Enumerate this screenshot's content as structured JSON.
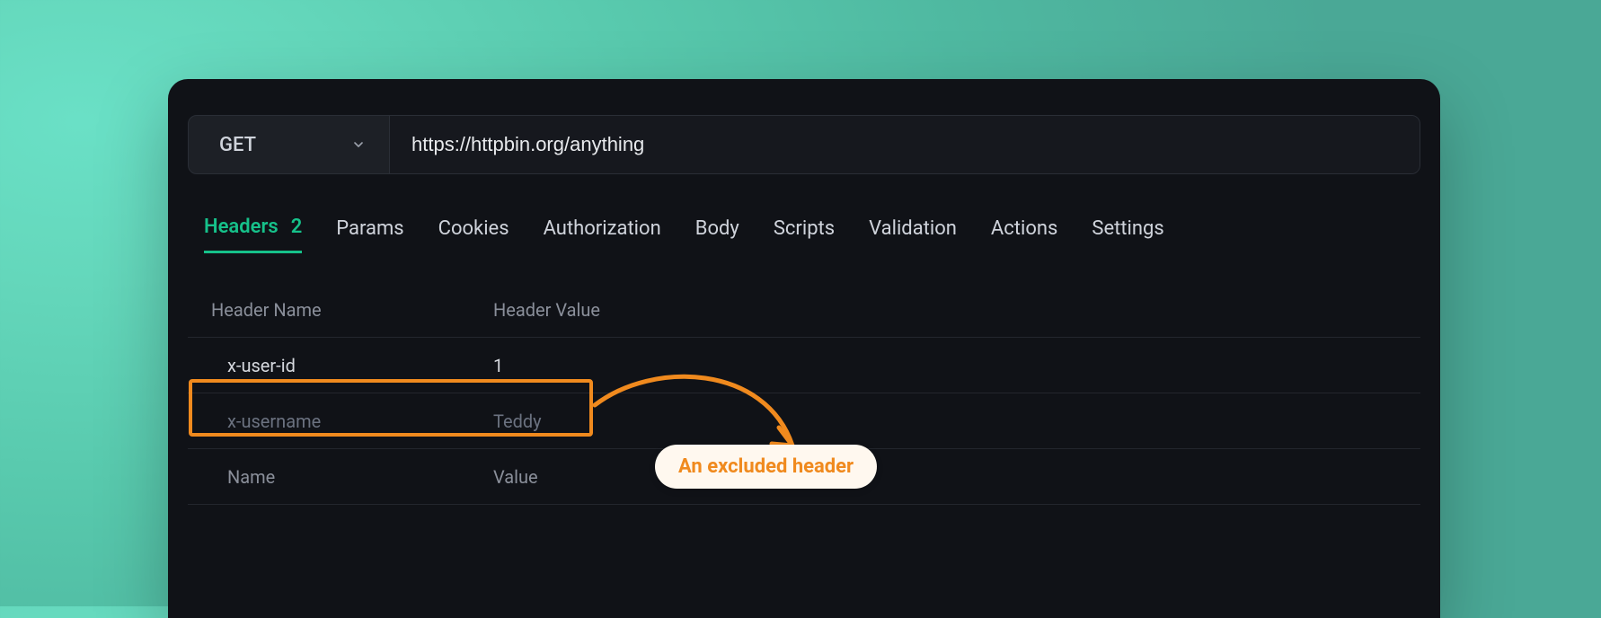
{
  "request": {
    "method": "GET",
    "url": "https://httpbin.org/anything"
  },
  "tabs": {
    "headers": {
      "label": "Headers",
      "count": "2"
    },
    "params": {
      "label": "Params"
    },
    "cookies": {
      "label": "Cookies"
    },
    "authorization": {
      "label": "Authorization"
    },
    "body": {
      "label": "Body"
    },
    "scripts": {
      "label": "Scripts"
    },
    "validation": {
      "label": "Validation"
    },
    "actions": {
      "label": "Actions"
    },
    "settings": {
      "label": "Settings"
    }
  },
  "headersTable": {
    "columns": {
      "name": "Header Name",
      "value": "Header Value"
    },
    "rows": [
      {
        "name": "x-user-id",
        "value": "1",
        "muted": false
      },
      {
        "name": "x-username",
        "value": "Teddy",
        "muted": true
      }
    ],
    "placeholder": {
      "name": "Name",
      "value": "Value"
    }
  },
  "annotation": {
    "label": "An excluded header"
  },
  "colors": {
    "accent": "#16c18a",
    "annotation": "#f08a1e",
    "panel": "#101217"
  }
}
